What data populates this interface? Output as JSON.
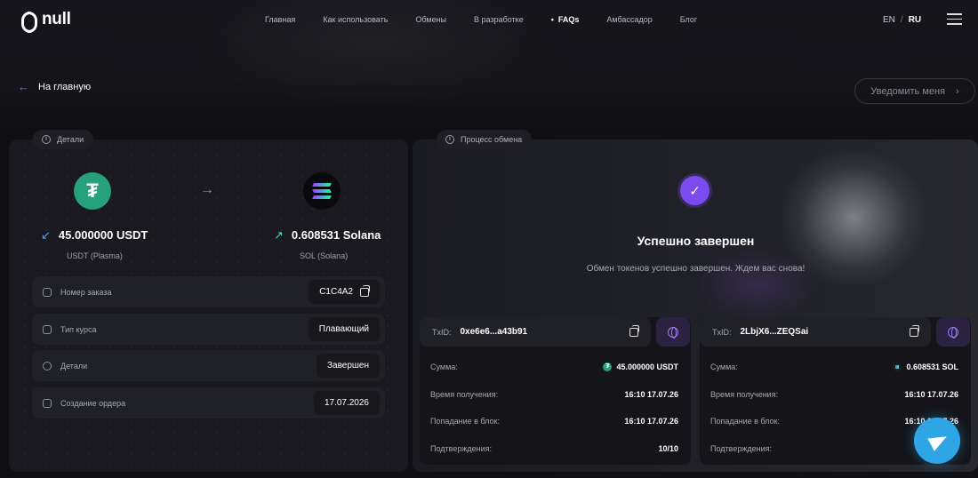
{
  "brand": {
    "name": "null"
  },
  "nav": {
    "items": [
      {
        "label": "Главная"
      },
      {
        "label": "Как использовать"
      },
      {
        "label": "Обмены"
      },
      {
        "label": "В разработке"
      },
      {
        "label": "FAQs"
      },
      {
        "label": "Амбассадор"
      },
      {
        "label": "Блог"
      }
    ],
    "active_index": 4
  },
  "lang": {
    "en": "EN",
    "separator": "/",
    "ru": "RU",
    "current": "RU"
  },
  "back": {
    "label": "На главную"
  },
  "notify": {
    "label": "Уведомить меня"
  },
  "details": {
    "section_label": "Детали",
    "from": {
      "amount": "45.000000 USDT",
      "network": "USDT (Plasma)",
      "icon": "tether-icon",
      "color": "#26a17b"
    },
    "to": {
      "amount": "0.608531 Solana",
      "network": "SOL (Solana)",
      "icon": "solana-icon"
    },
    "rows": [
      {
        "label": "Номер заказа",
        "value": "C1C4A2"
      },
      {
        "label": "Тип курса",
        "value": "Плавающий"
      },
      {
        "label": "Детали",
        "value": "Завершен"
      },
      {
        "label": "Создание ордера",
        "value": "17.07.2026"
      }
    ]
  },
  "process": {
    "section_label": "Процесс обмена",
    "title": "Успешно завершен",
    "subtitle": "Обмен токенов успешно завершен. Ждем вас снова!",
    "accent": "#7c4bf0",
    "tx": [
      {
        "txid_label": "TxID:",
        "txid": "0xe6e6...a43b91",
        "rows": [
          {
            "label": "Сумма:",
            "value": "45.000000 USDT"
          },
          {
            "label": "Время получения:",
            "value": "16:10 17.07.26"
          },
          {
            "label": "Попадание в блок:",
            "value": "16:10 17.07.26"
          },
          {
            "label": "Подтверждения:",
            "value": "10/10"
          }
        ]
      },
      {
        "txid_label": "TxID:",
        "txid": "2LbjX6...ZEQSai",
        "rows": [
          {
            "label": "Сумма:",
            "value": "0.608531 SOL"
          },
          {
            "label": "Время получения:",
            "value": "16:10 17.07.26"
          },
          {
            "label": "Попадание в блок:",
            "value": "16:10 17.07.26"
          },
          {
            "label": "Подтверждения:",
            "value": ""
          }
        ]
      }
    ]
  },
  "support": {
    "icon": "telegram-icon",
    "color": "#2ea6e6"
  }
}
